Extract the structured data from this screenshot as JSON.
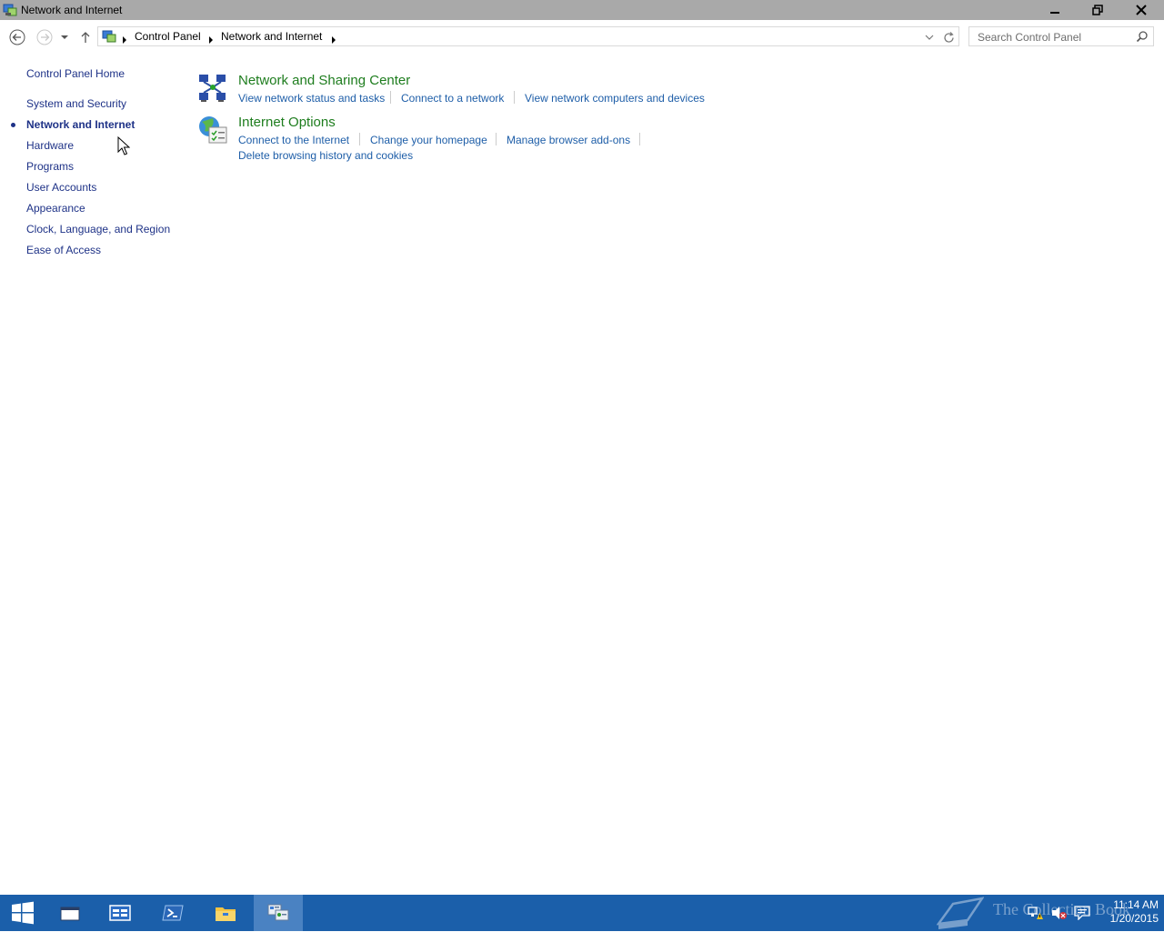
{
  "window": {
    "title": "Network and Internet"
  },
  "address": {
    "crumbs": [
      "Control Panel",
      "Network and Internet"
    ],
    "search_placeholder": "Search Control Panel"
  },
  "sidebar": {
    "home": "Control Panel Home",
    "items": [
      {
        "label": "System and Security",
        "current": false
      },
      {
        "label": "Network and Internet",
        "current": true
      },
      {
        "label": "Hardware",
        "current": false
      },
      {
        "label": "Programs",
        "current": false
      },
      {
        "label": "User Accounts",
        "current": false
      },
      {
        "label": "Appearance",
        "current": false
      },
      {
        "label": "Clock, Language, and Region",
        "current": false
      },
      {
        "label": "Ease of Access",
        "current": false
      }
    ]
  },
  "main": {
    "categories": [
      {
        "title": "Network and Sharing Center",
        "icon": "network-sharing-center-icon",
        "links": [
          "View network status and tasks",
          "Connect to a network",
          "View network computers and devices"
        ]
      },
      {
        "title": "Internet Options",
        "icon": "internet-options-icon",
        "links": [
          "Connect to the Internet",
          "Change your homepage",
          "Manage browser add-ons",
          "Delete browsing history and cookies"
        ]
      }
    ]
  },
  "taskbar": {
    "items": [
      "start-icon",
      "task-view-icon",
      "server-manager-icon",
      "powershell-icon",
      "file-explorer-icon",
      "control-panel-icon"
    ],
    "watermark": "The Collection Book",
    "time": "11:14 AM",
    "date": "1/20/2015"
  },
  "colors": {
    "titlebar": "#a9a9a9",
    "link": "#1e5ea8",
    "category_title": "#1e7d1e",
    "taskbar": "#1b5faa"
  }
}
